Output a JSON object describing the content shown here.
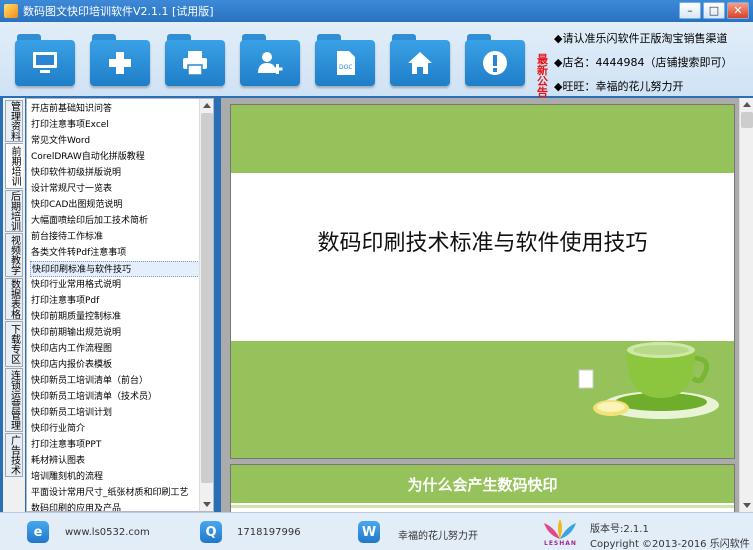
{
  "window": {
    "title": "数码图文快印培训软件V2.1.1 [试用版]",
    "minimize_glyph": "–",
    "restore_glyph": "□",
    "close_glyph": "✕"
  },
  "toolbar": {
    "buttons": [
      {
        "icon": "monitor-icon"
      },
      {
        "icon": "plus-icon"
      },
      {
        "icon": "printer-icon"
      },
      {
        "icon": "add-user-icon"
      },
      {
        "icon": "doc-icon",
        "caption": "DOC"
      },
      {
        "icon": "home-icon"
      },
      {
        "icon": "warning-icon"
      }
    ]
  },
  "notice": {
    "title": "最新公告",
    "lines": [
      "◆请认准乐闪软件正版淘宝销售渠道",
      "◆店名：4444984（店铺搜索即可）",
      "◆旺旺：幸福的花儿努力开"
    ]
  },
  "side_tabs": [
    "管理资料",
    "前期培训",
    "后期培训",
    "视频教学",
    "数据表格",
    "下载专区",
    "连锁运营管理",
    "广告技术"
  ],
  "doc_list": {
    "selected_index": 10,
    "items": [
      "开店前基础知识问答",
      "打印注意事项Excel",
      "常见文件Word",
      "CorelDRAW自动化拼版教程",
      "快印软件初级拼版说明",
      "设计常规尺寸一览表",
      "快印CAD出图规范说明",
      "大幅面喷绘印后加工技术简析",
      "前台接待工作标准",
      "各类文件转Pdf注意事项",
      "快印印刷标准与软件技巧",
      "快印行业常用格式说明",
      "打印注意事项Pdf",
      "快印前期质量控制标准",
      "快印前期输出规范说明",
      "快印店内工作流程图",
      "快印店内报价表模板",
      "快印新员工培训清单（前台）",
      "快印新员工培训清单（技术员）",
      "快印新员工培训计划",
      "快印行业简介",
      "打印注意事项PPT",
      "耗材辨认图表",
      "培训雕刻机的流程",
      "平面设计常用尺寸_纸张材质和印刷工艺",
      "数码印刷的应用及产品"
    ]
  },
  "viewer": {
    "slide1_title": "数码印刷技术标准与软件使用技巧",
    "slide2_title": "为什么会产生数码快印"
  },
  "statusbar": {
    "website": "www.ls0532.com",
    "qq": "1718197996",
    "wangwang": "幸福的花儿努力开",
    "logo_text": "LESHAN",
    "version": "版本号:2.1.1",
    "copyright": "Copyright ©2013-2016 乐闪软件"
  },
  "colors": {
    "slide_green": "#95c25a",
    "accent_blue": "#2a72c0",
    "notice_red": "#e4161b"
  }
}
